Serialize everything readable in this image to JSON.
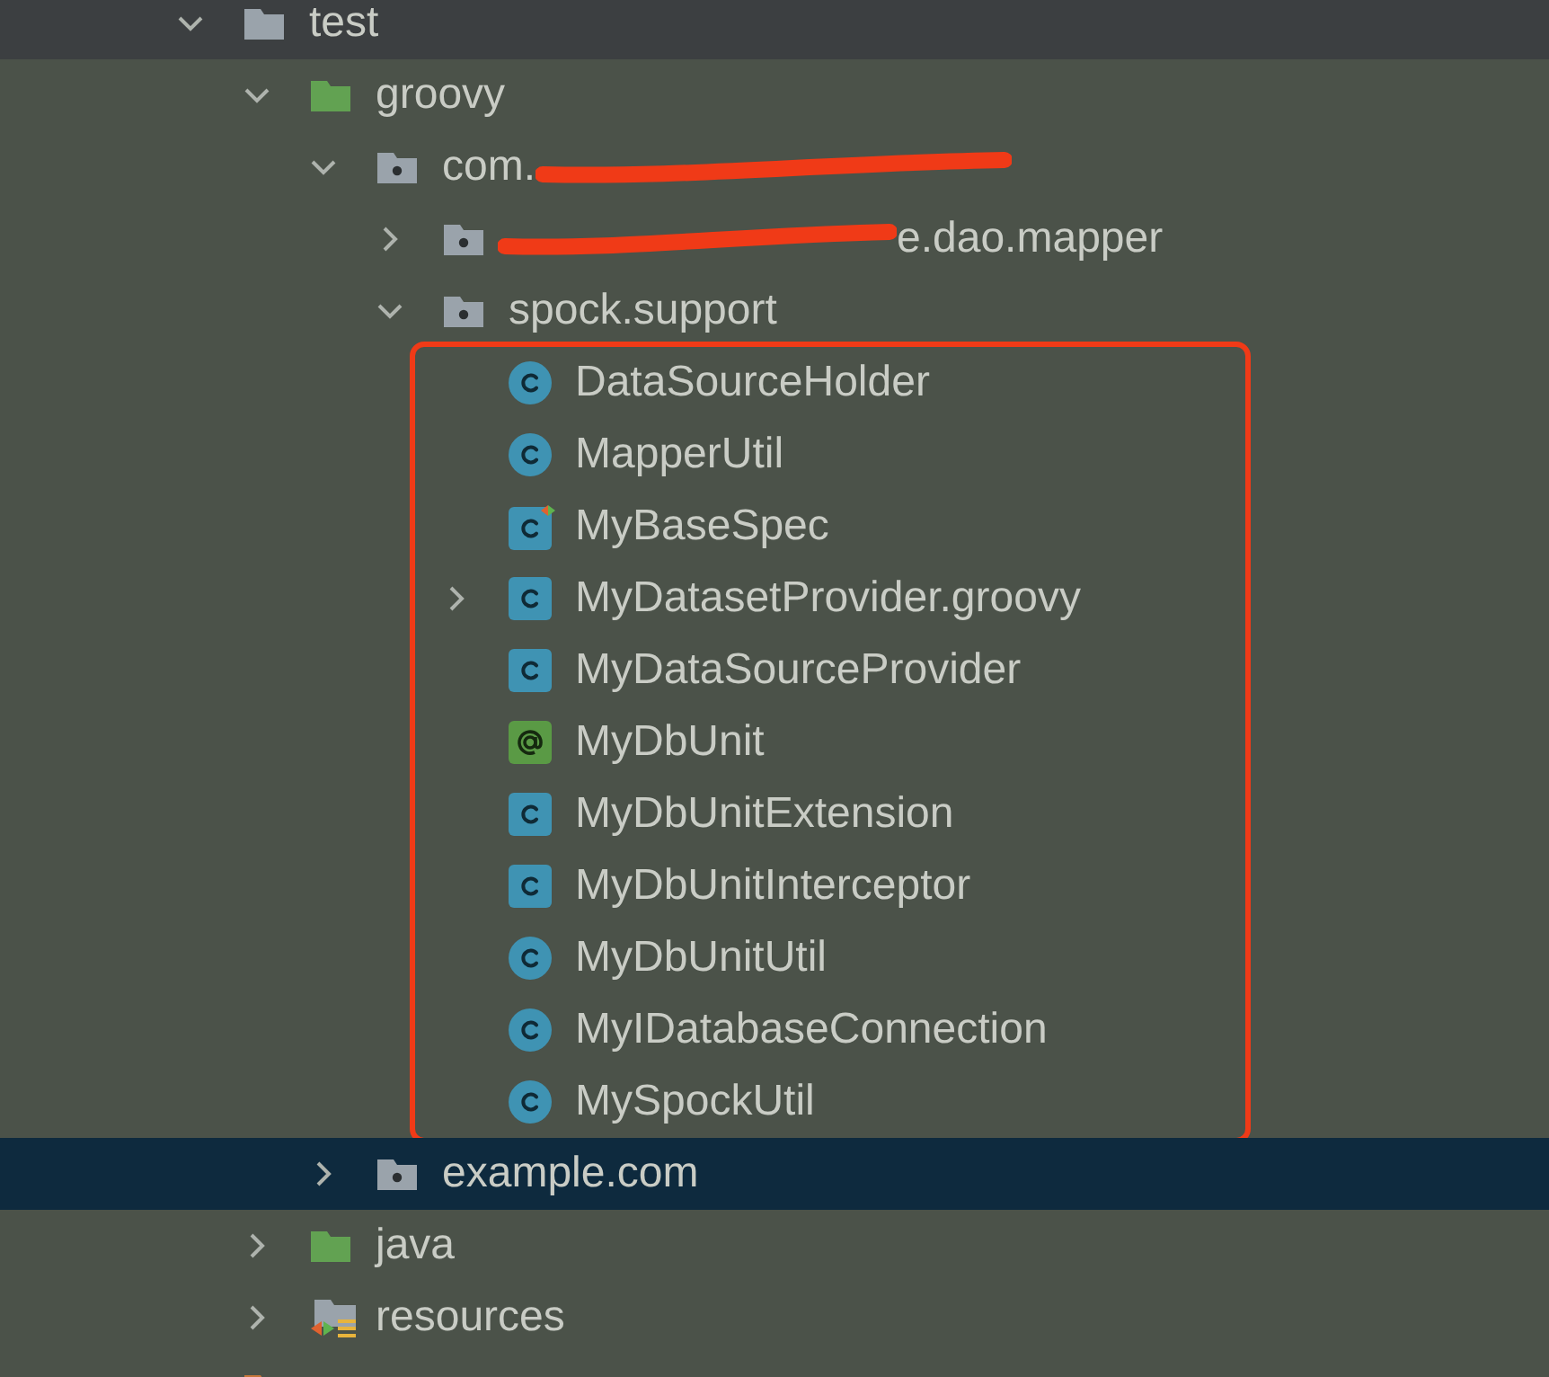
{
  "tree": [
    {
      "label": "test",
      "kind": "folder",
      "expanded": true,
      "sticky": true,
      "selected": false,
      "children": [
        {
          "label": "groovy",
          "kind": "source_folder",
          "expanded": true,
          "selected": false,
          "children": [
            {
              "label": "com.",
              "kind": "package",
              "expanded": true,
              "selected": false,
              "scribble_after": true,
              "children": [
                {
                  "label": "e.dao.mapper",
                  "kind": "package",
                  "expanded": false,
                  "selected": false,
                  "scribble_before": true
                },
                {
                  "label": "spock.support",
                  "kind": "package",
                  "expanded": true,
                  "selected": false,
                  "highlight_children": true,
                  "children": [
                    {
                      "label": "DataSourceHolder",
                      "kind": "class",
                      "selected": false
                    },
                    {
                      "label": "MapperUtil",
                      "kind": "class",
                      "selected": false
                    },
                    {
                      "label": "MyBaseSpec",
                      "kind": "spec",
                      "selected": false
                    },
                    {
                      "label": "MyDatasetProvider.groovy",
                      "kind": "class_file",
                      "expanded": false,
                      "selected": false
                    },
                    {
                      "label": "MyDataSourceProvider",
                      "kind": "class_file",
                      "selected": false
                    },
                    {
                      "label": "MyDbUnit",
                      "kind": "annotation",
                      "selected": false
                    },
                    {
                      "label": "MyDbUnitExtension",
                      "kind": "class_file",
                      "selected": false
                    },
                    {
                      "label": "MyDbUnitInterceptor",
                      "kind": "class_file",
                      "selected": false
                    },
                    {
                      "label": "MyDbUnitUtil",
                      "kind": "class",
                      "selected": false
                    },
                    {
                      "label": "MyIDatabaseConnection",
                      "kind": "class",
                      "selected": false
                    },
                    {
                      "label": "MySpockUtil",
                      "kind": "class",
                      "selected": false
                    }
                  ]
                }
              ]
            },
            {
              "label": "example.com",
              "kind": "package",
              "expanded": false,
              "selected": true
            }
          ]
        },
        {
          "label": "java",
          "kind": "source_folder",
          "expanded": false,
          "selected": false
        },
        {
          "label": "resources",
          "kind": "resources_folder",
          "expanded": false,
          "selected": false
        }
      ]
    },
    {
      "kind": "orange_folder",
      "selected": false
    }
  ]
}
